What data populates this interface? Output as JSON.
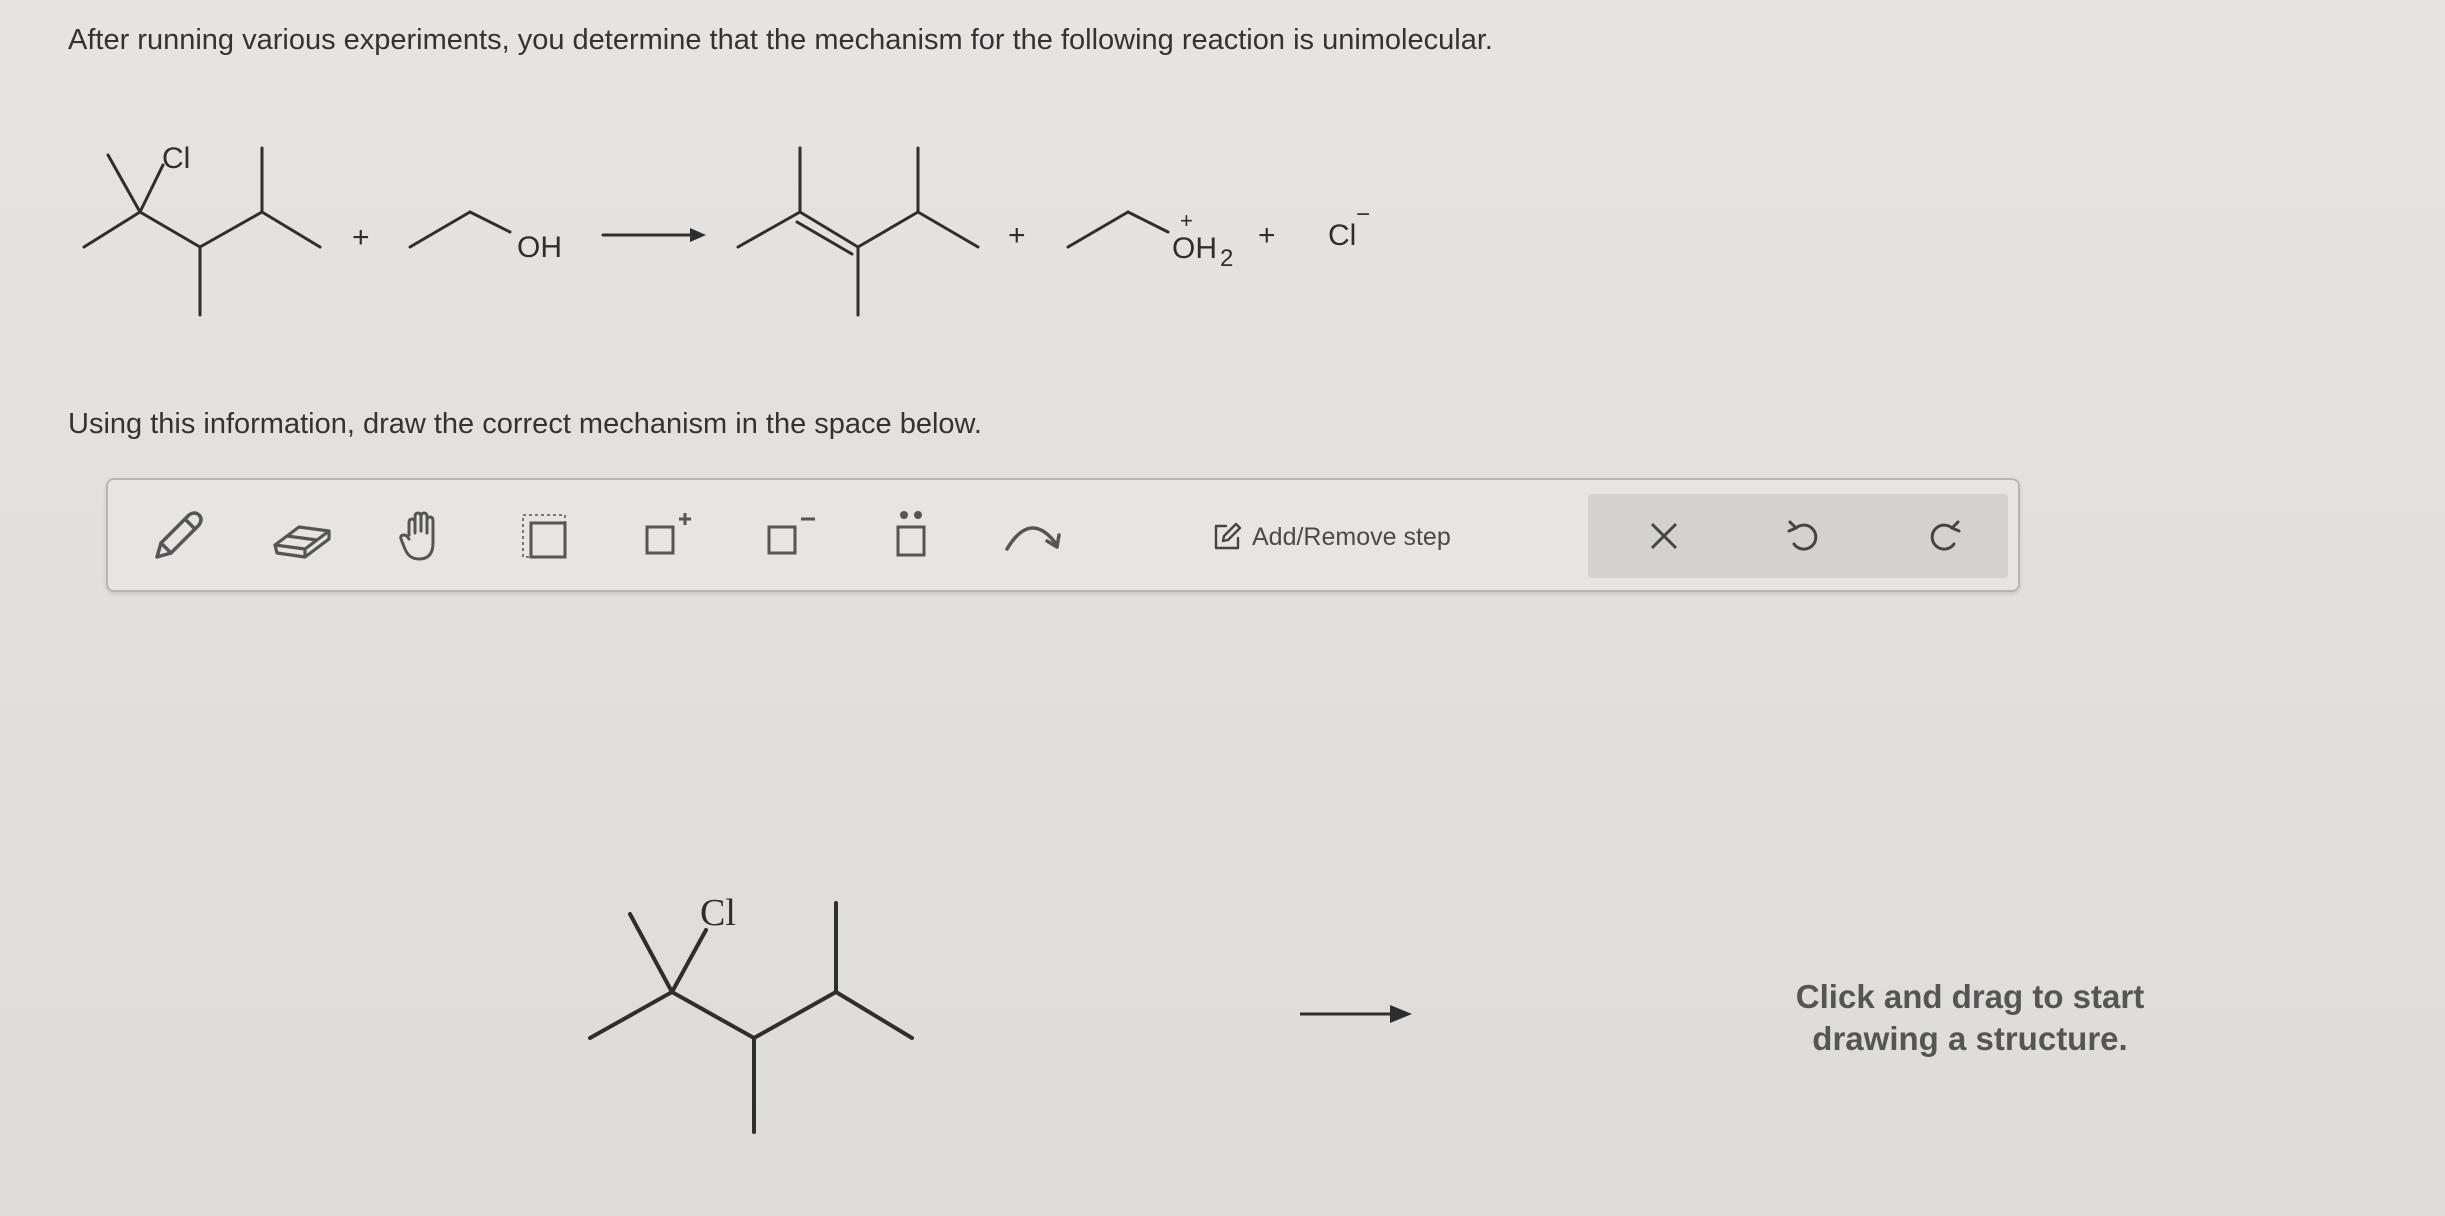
{
  "question": {
    "intro": "After running various experiments, you determine that the mechanism for the following reaction is unimolecular.",
    "instruction": "Using this information, draw the correct mechanism in the space below."
  },
  "reaction": {
    "reactant1_label": "Cl",
    "plus1": "+",
    "reactant2_label": "OH",
    "plus2": "+",
    "product2_charge": "+",
    "product2_label": "OH",
    "product2_subscript": "2",
    "plus3": "+",
    "product3_label": "Cl",
    "product3_charge": "−"
  },
  "toolbar": {
    "tools": [
      {
        "icon": "pencil-icon"
      },
      {
        "icon": "eraser-icon"
      },
      {
        "icon": "hand-icon"
      },
      {
        "icon": "select-box-icon"
      },
      {
        "icon": "positive-charge-icon"
      },
      {
        "icon": "negative-charge-icon"
      },
      {
        "icon": "lone-pair-icon"
      },
      {
        "icon": "curved-arrow-icon"
      }
    ],
    "add_remove_step": "Add/Remove step",
    "actions": [
      {
        "icon": "close-icon"
      },
      {
        "icon": "undo-icon"
      },
      {
        "icon": "redo-icon"
      }
    ]
  },
  "canvas": {
    "structure_label": "Cl",
    "hint_line1": "Click and drag to start",
    "hint_line2": "drawing a structure."
  }
}
